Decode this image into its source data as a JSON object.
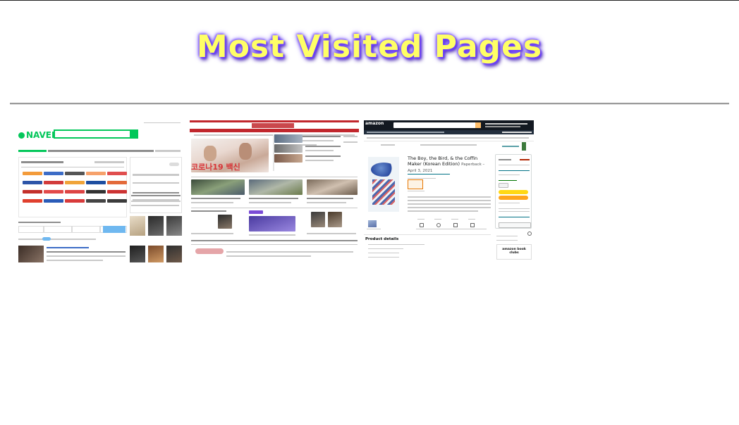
{
  "page": {
    "title": "Most Visited Pages"
  },
  "thumbnails": [
    {
      "site": "naver",
      "logo_text": "NAVER"
    },
    {
      "site": "news",
      "headline_banner": "코로나19 백신"
    },
    {
      "site": "amazon",
      "logo_text": "amazon",
      "book_title": "The Boy, the Bird, & the Coffin Maker (Korean Edition)",
      "book_format": "Paperback – April 3, 2021",
      "section_heading": "Product details",
      "ad_text": "amazon book clubs"
    }
  ],
  "colors": {
    "title_fill": "#ffff66",
    "title_shadow": "#6a3dff",
    "naver_green": "#03c75a",
    "news_red": "#c1272d",
    "amazon_dark": "#131921",
    "amazon_orange": "#febd69"
  }
}
